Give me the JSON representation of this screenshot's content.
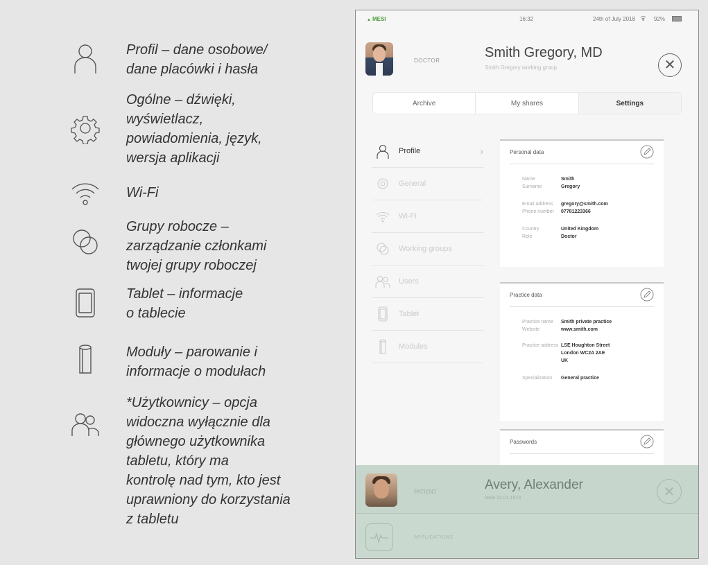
{
  "legend": [
    {
      "icon": "profile-icon",
      "text": "Profil – dane osobowe/\ndane placówki i hasła"
    },
    {
      "icon": "gear-icon",
      "text": "Ogólne – dźwięki,\nwyświetlacz,\npowiadomienia, język,\nwersja aplikacji"
    },
    {
      "icon": "wifi-icon",
      "text": "Wi-Fi"
    },
    {
      "icon": "working-groups-icon",
      "text": "Grupy robocze –\nzarządzanie członkami\ntwojej grupy roboczej"
    },
    {
      "icon": "tablet-icon",
      "text": "Tablet – informacje\no tablecie"
    },
    {
      "icon": "modules-icon",
      "text": "Moduły – parowanie i\ninformacje o modułach"
    },
    {
      "icon": "users-icon",
      "text": "*Użytkownicy – opcja\nwidoczna wyłącznie dla\ngłównego użytkownika\ntabletu, który ma\nkontrolę nad tym, kto jest\nuprawniony do korzystania\nz tabletu"
    }
  ],
  "statusbar": {
    "brand": "MESI",
    "time": "16:32",
    "date": "24th of July 2018",
    "battery": "92%"
  },
  "doctor": {
    "role": "DOCTOR",
    "name": "Smith Gregory, MD",
    "group": "Smith Gregory working group"
  },
  "tabs": [
    "Archive",
    "My shares",
    "Settings"
  ],
  "menu": [
    {
      "icon": "profile-icon",
      "label": "Profile",
      "active": true
    },
    {
      "icon": "gear-icon",
      "label": "General"
    },
    {
      "icon": "wifi-icon",
      "label": "Wi-Fi"
    },
    {
      "icon": "working-groups-icon",
      "label": "Working groups"
    },
    {
      "icon": "users-icon",
      "label": "Users"
    },
    {
      "icon": "tablet-icon",
      "label": "Tablet"
    },
    {
      "icon": "modules-icon",
      "label": "Modules"
    }
  ],
  "personal": {
    "title": "Personal data",
    "fields": [
      {
        "k": "Name",
        "v": "Smith"
      },
      {
        "k": "Surname",
        "v": "Gregory"
      },
      {
        "k": "Email address",
        "v": "gregory@smith.com"
      },
      {
        "k": "Phone number",
        "v": "07781223366"
      },
      {
        "k": "Country",
        "v": "United Kingdom"
      },
      {
        "k": "Role",
        "v": "Doctor"
      }
    ]
  },
  "practice": {
    "title": "Practice data",
    "fields": [
      {
        "k": "Practice name",
        "v": "Smith private practice"
      },
      {
        "k": "Website",
        "v": "www.smith.com"
      },
      {
        "k": "Practice address",
        "v": "LSE Houghton Street\nLondon WC2A 2AE\nUK"
      },
      {
        "k": "Specialization",
        "v": "General practice"
      }
    ]
  },
  "passwords": {
    "title": "Passwords"
  },
  "patient": {
    "role": "PATIENT",
    "name": "Avery, Alexander",
    "dob": "Male 22.01.1973"
  },
  "app": {
    "label": "APPLICATIONS"
  }
}
